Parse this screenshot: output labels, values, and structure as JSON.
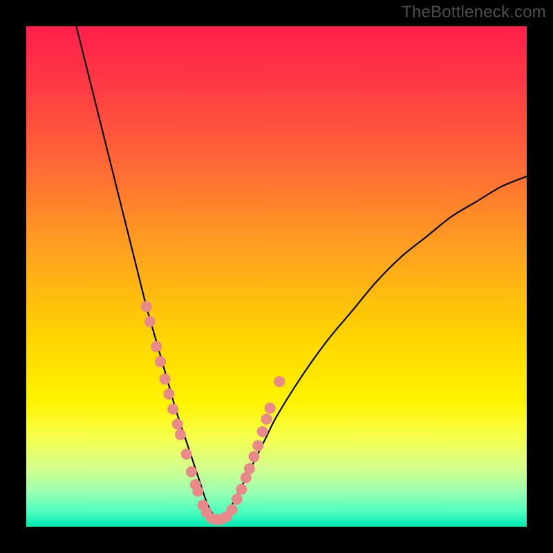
{
  "watermark": "TheBottleneck.com",
  "chart_data": {
    "type": "line",
    "title": "",
    "xlabel": "",
    "ylabel": "",
    "xlim": [
      0,
      100
    ],
    "ylim": [
      0,
      100
    ],
    "grid": false,
    "legend": false,
    "gradient_stops": [
      {
        "offset": 0.0,
        "color": "#ff1f4b"
      },
      {
        "offset": 0.12,
        "color": "#ff3a45"
      },
      {
        "offset": 0.28,
        "color": "#ff6a35"
      },
      {
        "offset": 0.45,
        "color": "#ffa21f"
      },
      {
        "offset": 0.62,
        "color": "#ffd400"
      },
      {
        "offset": 0.75,
        "color": "#fff300"
      },
      {
        "offset": 0.82,
        "color": "#f7ff4a"
      },
      {
        "offset": 0.88,
        "color": "#d6ff8a"
      },
      {
        "offset": 0.93,
        "color": "#9cffb0"
      },
      {
        "offset": 0.97,
        "color": "#4dffc0"
      },
      {
        "offset": 1.0,
        "color": "#00e8b0"
      }
    ],
    "series": [
      {
        "name": "curve",
        "stroke": "#000000",
        "x": [
          10,
          12,
          14,
          16,
          18,
          20,
          22,
          24,
          26,
          28,
          30,
          32,
          34,
          35,
          36,
          37,
          38,
          39,
          40,
          42,
          44,
          46,
          48,
          50,
          55,
          60,
          65,
          70,
          75,
          80,
          85,
          90,
          95,
          100
        ],
        "y": [
          100,
          92,
          84,
          76,
          68,
          60,
          52,
          44,
          37,
          30,
          23,
          17,
          11,
          8,
          5,
          3,
          1.5,
          1.5,
          2.5,
          6,
          10,
          14,
          18,
          22,
          30,
          37,
          43,
          49,
          54,
          58,
          62,
          65,
          68,
          70
        ]
      }
    ],
    "highlight_points": {
      "color": "#e88a8a",
      "radius_px": 8,
      "points": [
        {
          "x": 24.0,
          "y": 44.0
        },
        {
          "x": 24.7,
          "y": 41.0
        },
        {
          "x": 26.0,
          "y": 36.0
        },
        {
          "x": 26.8,
          "y": 33.0
        },
        {
          "x": 27.7,
          "y": 29.5
        },
        {
          "x": 28.5,
          "y": 26.5
        },
        {
          "x": 29.3,
          "y": 23.5
        },
        {
          "x": 30.2,
          "y": 20.5
        },
        {
          "x": 30.8,
          "y": 18.4
        },
        {
          "x": 32.0,
          "y": 14.5
        },
        {
          "x": 33.0,
          "y": 11.0
        },
        {
          "x": 33.8,
          "y": 8.4
        },
        {
          "x": 34.3,
          "y": 7.1
        },
        {
          "x": 35.3,
          "y": 4.3
        },
        {
          "x": 36.0,
          "y": 2.9
        },
        {
          "x": 37.0,
          "y": 1.7
        },
        {
          "x": 38.0,
          "y": 1.4
        },
        {
          "x": 39.0,
          "y": 1.5
        },
        {
          "x": 40.0,
          "y": 2.0
        },
        {
          "x": 41.1,
          "y": 3.4
        },
        {
          "x": 42.1,
          "y": 5.5
        },
        {
          "x": 43.0,
          "y": 7.5
        },
        {
          "x": 43.9,
          "y": 9.8
        },
        {
          "x": 44.6,
          "y": 11.6
        },
        {
          "x": 45.5,
          "y": 14.0
        },
        {
          "x": 46.3,
          "y": 16.2
        },
        {
          "x": 47.2,
          "y": 19.0
        },
        {
          "x": 48.0,
          "y": 21.5
        },
        {
          "x": 48.7,
          "y": 23.7
        },
        {
          "x": 50.6,
          "y": 29.0
        }
      ]
    }
  }
}
